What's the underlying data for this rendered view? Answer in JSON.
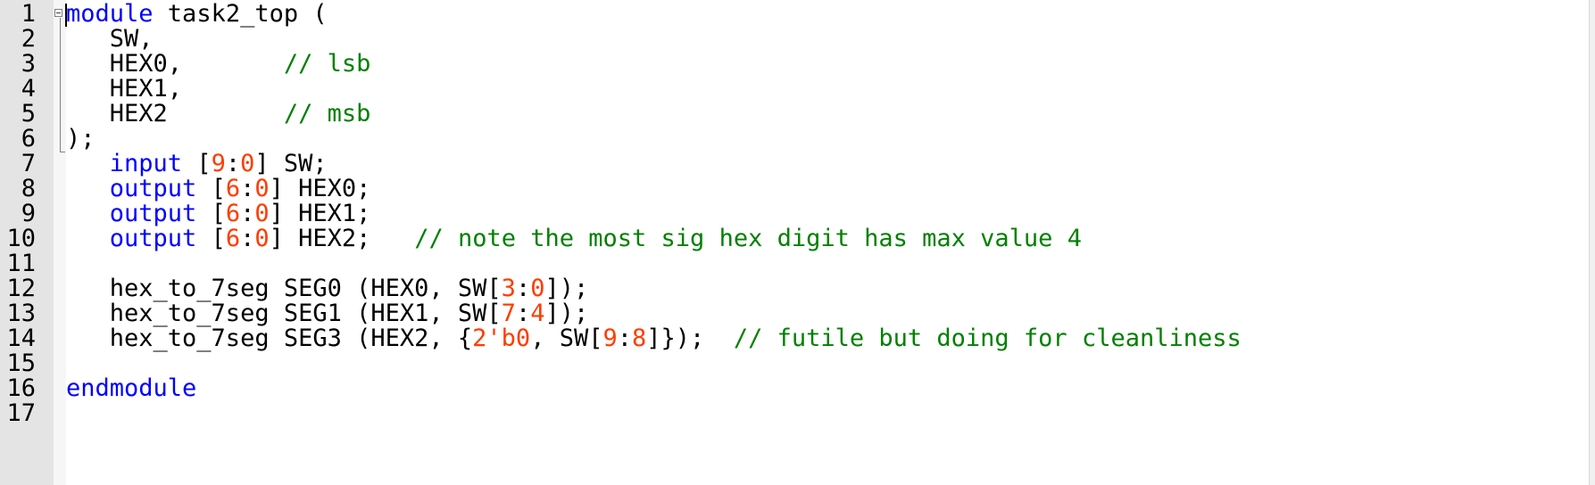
{
  "editor": {
    "theme": {
      "keyword_color": "#0000ff",
      "number_color": "#ff3c00",
      "comment_color": "#008000",
      "text_color": "#000000",
      "gutter_color": "#e4e4e4"
    },
    "lines": [
      {
        "number": "1",
        "tokens": [
          {
            "t": "kw",
            "text": "module"
          },
          {
            "t": "pl",
            "text": " task2_top ("
          }
        ]
      },
      {
        "number": "2",
        "tokens": [
          {
            "t": "pl",
            "text": "   SW,"
          }
        ]
      },
      {
        "number": "3",
        "tokens": [
          {
            "t": "pl",
            "text": "   HEX0,       "
          },
          {
            "t": "cm",
            "text": "// lsb"
          }
        ]
      },
      {
        "number": "4",
        "tokens": [
          {
            "t": "pl",
            "text": "   HEX1,"
          }
        ]
      },
      {
        "number": "5",
        "tokens": [
          {
            "t": "pl",
            "text": "   HEX2        "
          },
          {
            "t": "cm",
            "text": "// msb"
          }
        ]
      },
      {
        "number": "6",
        "tokens": [
          {
            "t": "pl",
            "text": ");"
          }
        ]
      },
      {
        "number": "7",
        "tokens": [
          {
            "t": "pl",
            "text": "   "
          },
          {
            "t": "kw",
            "text": "input"
          },
          {
            "t": "pl",
            "text": " ["
          },
          {
            "t": "num",
            "text": "9"
          },
          {
            "t": "pl",
            "text": ":"
          },
          {
            "t": "num",
            "text": "0"
          },
          {
            "t": "pl",
            "text": "] SW;"
          }
        ]
      },
      {
        "number": "8",
        "tokens": [
          {
            "t": "pl",
            "text": "   "
          },
          {
            "t": "kw",
            "text": "output"
          },
          {
            "t": "pl",
            "text": " ["
          },
          {
            "t": "num",
            "text": "6"
          },
          {
            "t": "pl",
            "text": ":"
          },
          {
            "t": "num",
            "text": "0"
          },
          {
            "t": "pl",
            "text": "] HEX0;"
          }
        ]
      },
      {
        "number": "9",
        "tokens": [
          {
            "t": "pl",
            "text": "   "
          },
          {
            "t": "kw",
            "text": "output"
          },
          {
            "t": "pl",
            "text": " ["
          },
          {
            "t": "num",
            "text": "6"
          },
          {
            "t": "pl",
            "text": ":"
          },
          {
            "t": "num",
            "text": "0"
          },
          {
            "t": "pl",
            "text": "] HEX1;"
          }
        ]
      },
      {
        "number": "10",
        "tokens": [
          {
            "t": "pl",
            "text": "   "
          },
          {
            "t": "kw",
            "text": "output"
          },
          {
            "t": "pl",
            "text": " ["
          },
          {
            "t": "num",
            "text": "6"
          },
          {
            "t": "pl",
            "text": ":"
          },
          {
            "t": "num",
            "text": "0"
          },
          {
            "t": "pl",
            "text": "] HEX2;   "
          },
          {
            "t": "cm",
            "text": "// note the most sig hex digit has max value 4"
          }
        ]
      },
      {
        "number": "11",
        "tokens": []
      },
      {
        "number": "12",
        "tokens": [
          {
            "t": "pl",
            "text": "   hex_to_7seg SEG0 (HEX0, SW["
          },
          {
            "t": "num",
            "text": "3"
          },
          {
            "t": "pl",
            "text": ":"
          },
          {
            "t": "num",
            "text": "0"
          },
          {
            "t": "pl",
            "text": "]);"
          }
        ]
      },
      {
        "number": "13",
        "tokens": [
          {
            "t": "pl",
            "text": "   hex_to_7seg SEG1 (HEX1, SW["
          },
          {
            "t": "num",
            "text": "7"
          },
          {
            "t": "pl",
            "text": ":"
          },
          {
            "t": "num",
            "text": "4"
          },
          {
            "t": "pl",
            "text": "]);"
          }
        ]
      },
      {
        "number": "14",
        "tokens": [
          {
            "t": "pl",
            "text": "   hex_to_7seg SEG3 (HEX2, {"
          },
          {
            "t": "num",
            "text": "2'b0"
          },
          {
            "t": "pl",
            "text": ", SW["
          },
          {
            "t": "num",
            "text": "9"
          },
          {
            "t": "pl",
            "text": ":"
          },
          {
            "t": "num",
            "text": "8"
          },
          {
            "t": "pl",
            "text": "]});  "
          },
          {
            "t": "cm",
            "text": "// futile but doing for cleanliness"
          }
        ]
      },
      {
        "number": "15",
        "tokens": []
      },
      {
        "number": "16",
        "tokens": [
          {
            "t": "kw",
            "text": "endmodule"
          }
        ]
      },
      {
        "number": "17",
        "tokens": []
      }
    ]
  },
  "icons": {
    "fold_marker": "fold-collapse-icon"
  }
}
